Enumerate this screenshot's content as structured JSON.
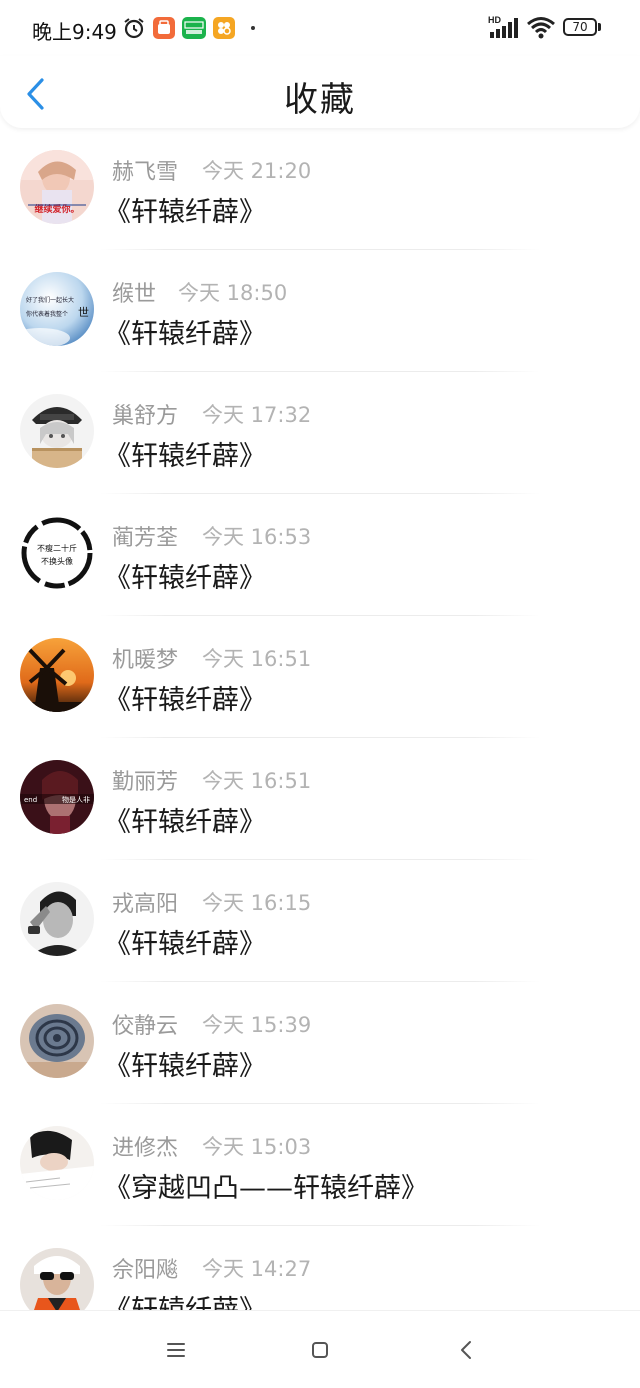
{
  "status_bar": {
    "time": "晚上9:49",
    "icons": [
      "alarm-icon",
      "app-notification-icon",
      "iqiyi-icon",
      "app-notification-icon",
      "hd-icon",
      "signal-icon",
      "wifi-icon",
      "battery-icon"
    ],
    "battery": "70"
  },
  "header": {
    "title": "收藏",
    "back_icon": "chevron-left-icon"
  },
  "items": [
    {
      "name": "赫飞雪",
      "time": "今天 21:20",
      "title": "《轩辕纤薜》"
    },
    {
      "name": "缑世",
      "time": "今天 18:50",
      "title": "《轩辕纤薜》"
    },
    {
      "name": "巢舒方",
      "time": "今天 17:32",
      "title": "《轩辕纤薜》"
    },
    {
      "name": "蔺芳荃",
      "time": "今天 16:53",
      "title": "《轩辕纤薜》"
    },
    {
      "name": "机暖梦",
      "time": "今天 16:51",
      "title": "《轩辕纤薜》"
    },
    {
      "name": "勤丽芳",
      "time": "今天 16:51",
      "title": "《轩辕纤薜》"
    },
    {
      "name": "戎高阳",
      "time": "今天 16:15",
      "title": "《轩辕纤薜》"
    },
    {
      "name": "佼静云",
      "time": "今天 15:39",
      "title": "《轩辕纤薜》"
    },
    {
      "name": "进修杰",
      "time": "今天 15:03",
      "title": "《穿越凹凸——轩辕纤薜》"
    },
    {
      "name": "佘阳飚",
      "time": "今天 14:27",
      "title": "《轩辕纤薜》"
    }
  ],
  "avatar_texts": {
    "a1": "继续爱你。",
    "a2_line1": "好了我们一起长大",
    "a2_line2": "你代表着我整个",
    "a2_big": "世",
    "a4_line1": "不瘦二十斤",
    "a4_line2": "不换头像",
    "a6_left": "end",
    "a6_right": "物是人非"
  },
  "nav_bar": {
    "menu_icon": "menu-icon",
    "home_icon": "home-square-icon",
    "back_icon": "back-chevron-icon"
  }
}
